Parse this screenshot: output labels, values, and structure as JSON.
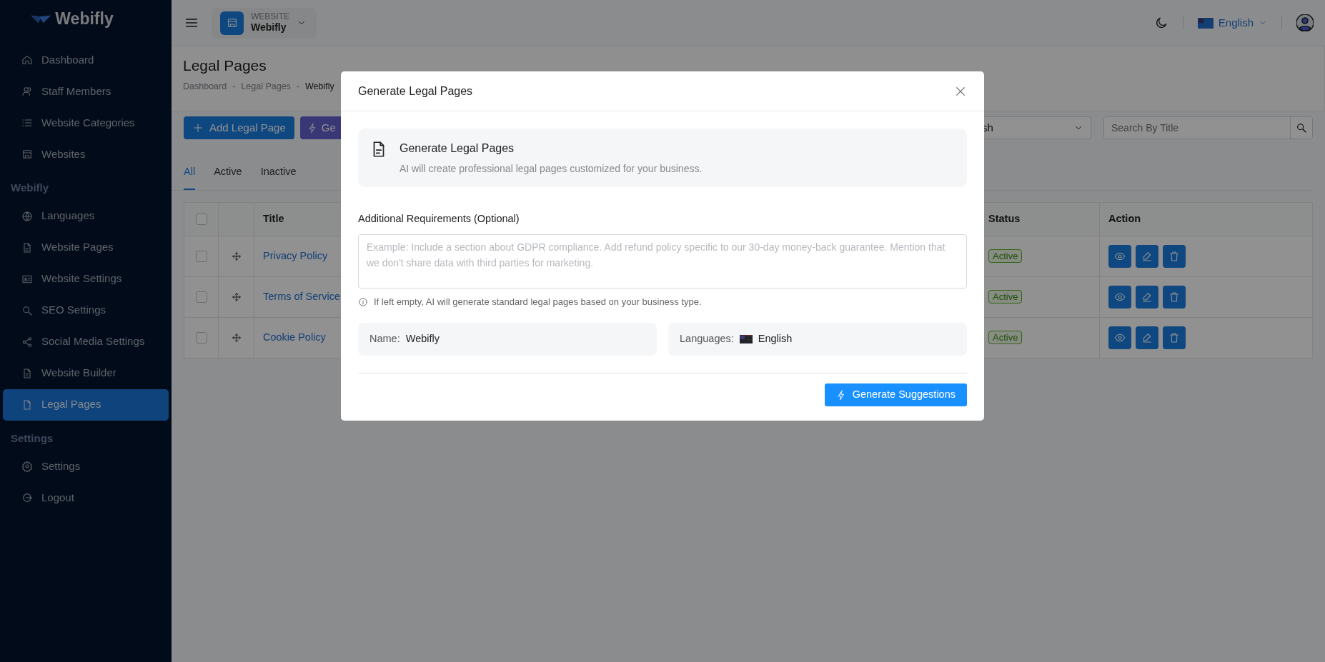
{
  "sidebar": {
    "brand": "Webifly",
    "sections": [
      {
        "items": [
          {
            "label": "Dashboard",
            "selected": false
          },
          {
            "label": "Staff Members",
            "selected": false
          },
          {
            "label": "Website Categories",
            "selected": false
          },
          {
            "label": "Websites",
            "selected": false
          }
        ]
      },
      {
        "title": "Webifly",
        "items": [
          {
            "label": "Languages",
            "selected": false
          },
          {
            "label": "Website Pages",
            "selected": false
          },
          {
            "label": "Website Settings",
            "selected": false
          },
          {
            "label": "SEO Settings",
            "selected": false
          },
          {
            "label": "Social Media Settings",
            "selected": false
          },
          {
            "label": "Website Builder",
            "selected": false
          },
          {
            "label": "Legal Pages",
            "selected": true
          }
        ]
      },
      {
        "title": "Settings",
        "items": [
          {
            "label": "Settings",
            "selected": false
          },
          {
            "label": "Logout",
            "selected": false
          }
        ]
      }
    ]
  },
  "header": {
    "website_label": "WEBSITE",
    "website_name": "Webifly",
    "language": "English"
  },
  "page": {
    "title": "Legal Pages",
    "breadcrumb": [
      "Dashboard",
      "Legal Pages",
      "Webifly"
    ],
    "breadcrumb_separator": "-"
  },
  "toolbar": {
    "buttons": [
      {
        "label": "Add Legal Page",
        "kind": "add"
      },
      {
        "label": "Ge",
        "kind": "generate"
      }
    ],
    "language_select": "sh",
    "search": {
      "placeholder": "Search By Title"
    }
  },
  "tabs": [
    {
      "label": "All",
      "selected": true
    },
    {
      "label": "Active",
      "selected": false
    },
    {
      "label": "Inactive",
      "selected": false
    }
  ],
  "table": {
    "columns": [
      "Title",
      "Status",
      "Action"
    ],
    "header_checked": false,
    "rows": [
      {
        "title": "Privacy Policy",
        "status": "Active",
        "checked": false
      },
      {
        "title": "Terms of Service",
        "status": "Active",
        "checked": false
      },
      {
        "title": "Cookie Policy",
        "status": "Active",
        "checked": false
      }
    ]
  },
  "modal": {
    "title": "Generate Legal Pages",
    "intro_title": "Generate Legal Pages",
    "intro_text": "AI will create professional legal pages customized for your business.",
    "field_label": "Additional Requirements (Optional)",
    "field_placeholder": "Example: Include a section about GDPR compliance. Add refund policy specific to our 30-day money-back guarantee. Mention that we don't share data with third parties for marketing.",
    "help_text": "If left empty, AI will generate standard legal pages based on your business type.",
    "name_label": "Name:",
    "name_value": "Webifly",
    "languages_label": "Languages:",
    "languages_value": "English",
    "submit": "Generate Suggestions"
  }
}
